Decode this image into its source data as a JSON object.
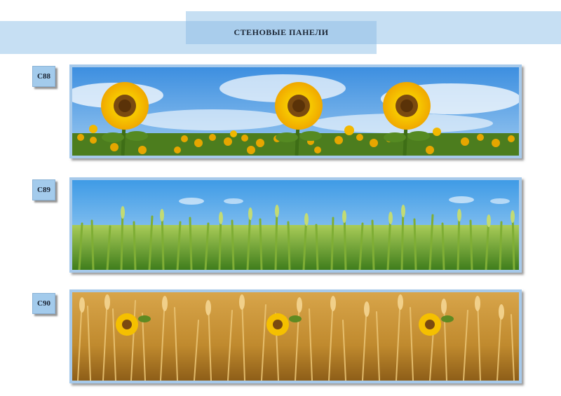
{
  "header": {
    "title": "СТЕНОВЫЕ ПАНЕЛИ"
  },
  "panels": [
    {
      "code": "C88",
      "image": "sunflower-field-icon"
    },
    {
      "code": "C89",
      "image": "green-wheat-field-icon"
    },
    {
      "code": "C90",
      "image": "golden-wheat-field-icon"
    }
  ],
  "colors": {
    "band": "#c6dff3",
    "title_box": "#a9cdec",
    "tag": "#a3cbec",
    "panel_border": "#a6c9ea"
  }
}
